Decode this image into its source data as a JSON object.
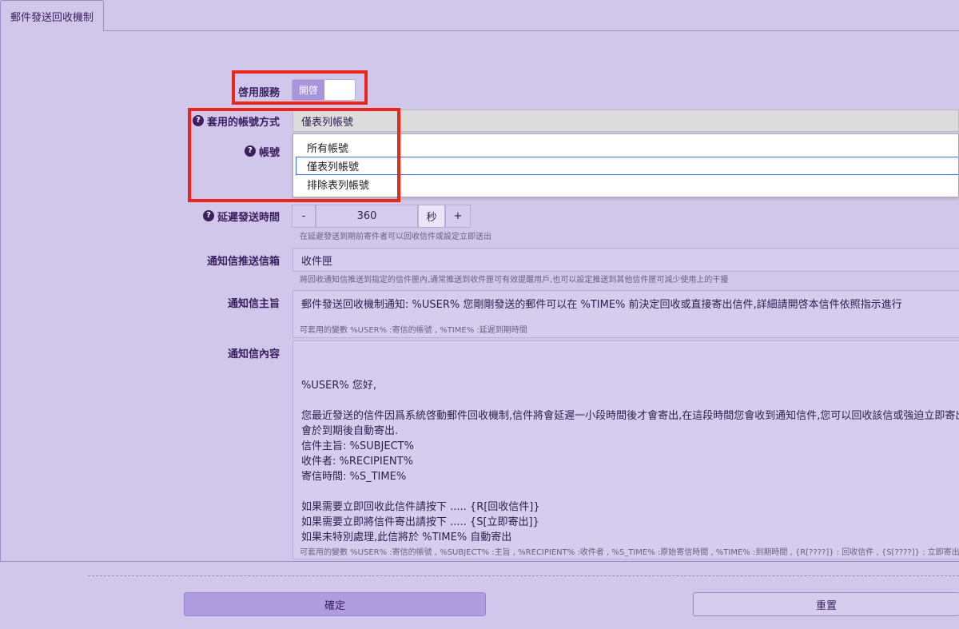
{
  "tab": {
    "label": "郵件發送回收機制"
  },
  "form": {
    "enable": {
      "label": "啓用服務",
      "toggle_label": "開啓"
    },
    "account_mode": {
      "label": "套用的帳號方式",
      "selected": "僅表列帳號",
      "options": [
        "所有帳號",
        "僅表列帳號",
        "排除表列帳號"
      ]
    },
    "account": {
      "label": "帳號"
    },
    "delay": {
      "label": "延遲發送時間",
      "minus": "-",
      "value": "360",
      "unit": "秒",
      "plus": "+",
      "hint": "在延遲發送到期前寄件者可以回收信件或設定立即送出"
    },
    "mailbox": {
      "label": "通知信推送信箱",
      "value": "收件匣",
      "hint": "將回收通知信推送到指定的信件匣內,通常推送到收件匣可有效提醒用戶,也可以設定推送到其他信件匣可減少使用上的干擾"
    },
    "subject": {
      "label": "通知信主旨",
      "value": "郵件發送回收機制通知: %USER% 您剛剛發送的郵件可以在 %TIME% 前決定回收或直接寄出信件,詳細請開啓本信件依照指示進行",
      "hint": "可套用的變數 %USER% :寄信的帳號 , %TIME% :延遲到期時間"
    },
    "content": {
      "label": "通知信內容",
      "value": "%USER% 您好,\n\n您最近發送的信件因爲系統啓動郵件回收機制,信件將會延遲一小段時間後才會寄出,在這段時間您會收到通知信件,您可以回收該信或強迫立即寄出,如果\n會於到期後自動寄出.\n信件主旨: %SUBJECT%\n收件者: %RECIPIENT%\n寄信時間: %S_TIME%\n\n如果需要立即回收此信件請按下 ..... {R[回收信件]}\n如果需要立即將信件寄出請按下 ..... {S[立即寄出]}\n如果未特別處理,此信將於 %TIME% 自動寄出",
      "hint": "可套用的變數 %USER% :寄信的帳號 , %SUBJECT% :主旨 , %RECIPIENT% :收件者 , %S_TIME% :原始寄信時間 , %TIME% :到期時間 , {R[????]} : 回收信件 , {S[????]} : 立即寄出"
    }
  },
  "buttons": {
    "confirm": "確定",
    "reset": "重置"
  },
  "colors": {
    "background": "#d1c7ea",
    "highlight": "#e8271c",
    "button_primary": "#b09ddf"
  }
}
